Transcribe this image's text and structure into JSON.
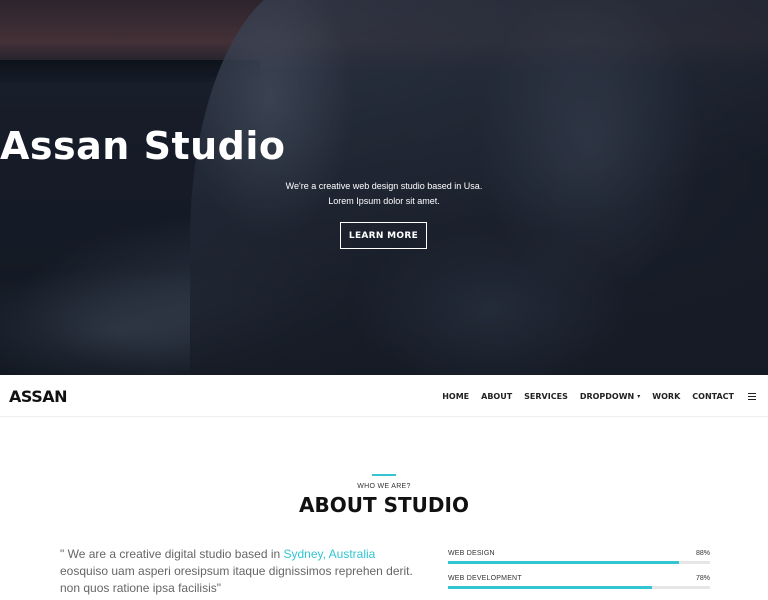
{
  "hero": {
    "title": "Assan Studio",
    "subtitle": "We're a creative web design studio based in Usa. Lorem Ipsum dolor sit amet.",
    "cta_label": "LEARN MORE"
  },
  "navbar": {
    "brand": "ASSAN",
    "links": [
      {
        "label": "HOME"
      },
      {
        "label": "ABOUT"
      },
      {
        "label": "SERVICES"
      },
      {
        "label": "DROPDOWN"
      },
      {
        "label": "WORK"
      },
      {
        "label": "CONTACT"
      }
    ],
    "dropdown_caret": "▾",
    "menu_icon": "list-icon"
  },
  "about": {
    "eyebrow": "WHO WE ARE?",
    "title": "ABOUT STUDIO",
    "text_before": "\" We are a creative digital studio based in ",
    "text_highlight": "Sydney, Australia",
    "text_after": " eosquiso uam asperi oresipsum itaque dignissimos reprehen derit. non quos ratione ipsa facilisis\"",
    "skills": [
      {
        "label": "WEB DESIGN",
        "percent_label": "88%",
        "value": 0.88
      },
      {
        "label": "WEB DEVELOPMENT",
        "percent_label": "78%",
        "value": 0.78
      }
    ]
  },
  "colors": {
    "accent": "#32c5d2",
    "text_dark": "#111111",
    "text_muted": "#666666"
  }
}
